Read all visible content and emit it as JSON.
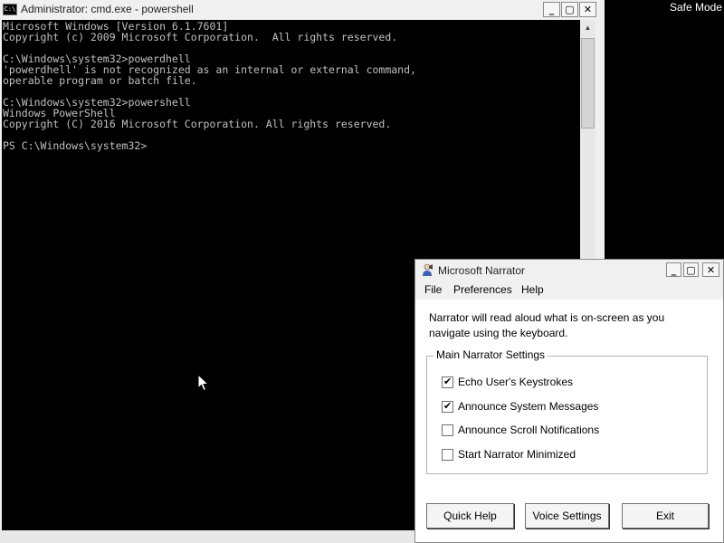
{
  "desktop": {
    "safe_mode": "Safe Mode"
  },
  "cmd": {
    "title": "Administrator: cmd.exe - powershell",
    "icon_label": "C:\\",
    "buttons": {
      "minimize": "_",
      "maximize": "▢",
      "close": "✕"
    },
    "lines": [
      "Microsoft Windows [Version 6.1.7601]",
      "Copyright (c) 2009 Microsoft Corporation.  All rights reserved.",
      "",
      "C:\\Windows\\system32>powerdhell",
      "'powerdhell' is not recognized as an internal or external command,",
      "operable program or batch file.",
      "",
      "C:\\Windows\\system32>powershell",
      "Windows PowerShell",
      "Copyright (C) 2016 Microsoft Corporation. All rights reserved.",
      "",
      "PS C:\\Windows\\system32>"
    ]
  },
  "narrator": {
    "title": "Microsoft Narrator",
    "menu": [
      "File",
      "Preferences",
      "Help"
    ],
    "description": "Narrator will read aloud what is on-screen as you navigate using the keyboard.",
    "group_label": "Main Narrator Settings",
    "options": [
      {
        "label": "Echo User's Keystrokes",
        "checked": true
      },
      {
        "label": "Announce System Messages",
        "checked": true
      },
      {
        "label": "Announce Scroll Notifications",
        "checked": false
      },
      {
        "label": "Start Narrator Minimized",
        "checked": false
      }
    ],
    "buttons": {
      "quick_help": "Quick Help",
      "voice_settings": "Voice Settings",
      "exit": "Exit"
    }
  },
  "icons": {
    "cmd_app": "command-prompt-icon",
    "narrator_app": "narrator-icon",
    "pointer": "mouse-cursor-icon"
  }
}
